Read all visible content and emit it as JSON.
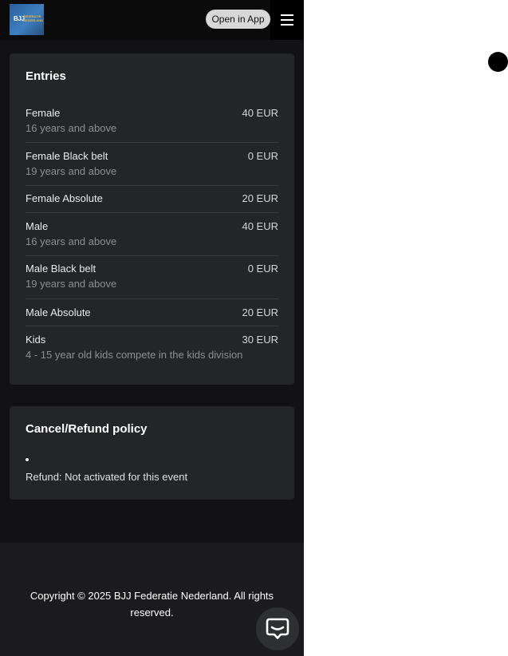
{
  "header": {
    "logo_text": "BJJ",
    "logo_subtext": "FEDERATIE NEDERLAND",
    "open_app_label": "Open in App",
    "menu_icon": "hamburger-menu-icon"
  },
  "entries": {
    "title": "Entries",
    "items": [
      {
        "name": "Female",
        "price": "40 EUR",
        "sub": "16 years and above"
      },
      {
        "name": "Female Black belt",
        "price": "0 EUR",
        "sub": "19 years and above"
      },
      {
        "name": "Female Absolute",
        "price": "20 EUR",
        "sub": ""
      },
      {
        "name": "Male",
        "price": "40 EUR",
        "sub": "16 years and above"
      },
      {
        "name": "Male Black belt",
        "price": "0 EUR",
        "sub": "19 years and above"
      },
      {
        "name": "Male Absolute",
        "price": "20 EUR",
        "sub": ""
      },
      {
        "name": "Kids",
        "price": "30 EUR",
        "sub": "4 - 15 year old kids compete in the kids division"
      }
    ]
  },
  "refund_policy": {
    "title": "Cancel/Refund policy",
    "text": "Refund: Not activated for this event"
  },
  "footer": {
    "copyright": "Copyright © 2025 BJJ Federatie Nederland. All rights reserved."
  },
  "chat": {
    "icon": "chat-icon"
  },
  "colors": {
    "background": "#121214",
    "card": "#242527",
    "footer": "#1b1b1d",
    "muted_text": "#8e8e92",
    "pill": "#d8d8d8"
  }
}
